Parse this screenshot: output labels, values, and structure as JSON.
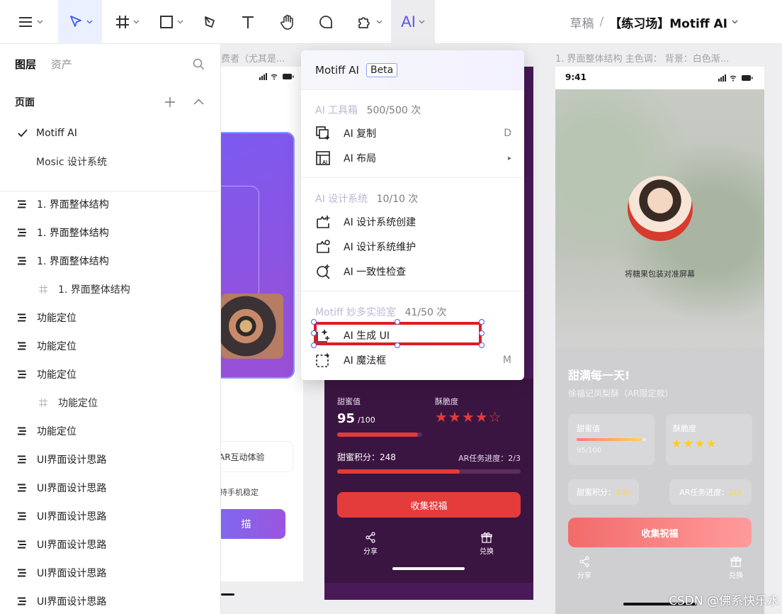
{
  "toolbar": {
    "ai_label": "AI",
    "tools": [
      "menu-icon",
      "pointer-icon",
      "frame-icon",
      "rectangle-icon",
      "pen-icon",
      "text-icon",
      "hand-icon",
      "comment-icon",
      "plugin-icon"
    ]
  },
  "breadcrumb": {
    "project": "草稿",
    "separator": "/",
    "file": "【练习场】Motiff AI"
  },
  "left_panel": {
    "tabs": [
      "图层",
      "资产"
    ],
    "pages_title": "页面",
    "pages": [
      {
        "name": "Motiff AI",
        "current": true
      },
      {
        "name": "Mosic 设计系统",
        "current": false
      }
    ],
    "layers": [
      {
        "name": "1. 界面整体结构",
        "type": "section"
      },
      {
        "name": "1. 界面整体结构",
        "type": "section"
      },
      {
        "name": "1. 界面整体结构",
        "type": "section"
      },
      {
        "name": "1. 界面整体结构",
        "type": "frame"
      },
      {
        "name": "功能定位",
        "type": "section"
      },
      {
        "name": "功能定位",
        "type": "section"
      },
      {
        "name": "功能定位",
        "type": "section"
      },
      {
        "name": "功能定位",
        "type": "frame"
      },
      {
        "name": "功能定位",
        "type": "section"
      },
      {
        "name": "UI界面设计思路",
        "type": "section"
      },
      {
        "name": "UI界面设计思路",
        "type": "section"
      },
      {
        "name": "UI界面设计思路",
        "type": "section"
      },
      {
        "name": "UI界面设计思路",
        "type": "section"
      },
      {
        "name": "UI界面设计思路",
        "type": "section"
      },
      {
        "name": "UI界面设计思路",
        "type": "section"
      }
    ]
  },
  "ai_menu": {
    "title": "Motiff AI",
    "badge": "Beta",
    "sections": [
      {
        "name": "AI 工具箱",
        "quota": "500/500 次",
        "items": [
          {
            "label": "AI 复制",
            "shortcut": "D",
            "icon": "ai-copy-icon"
          },
          {
            "label": "AI 布局",
            "shortcut": "▸",
            "icon": "ai-layout-icon"
          }
        ]
      },
      {
        "name": "AI 设计系统",
        "quota": "10/10 次",
        "items": [
          {
            "label": "AI 设计系统创建",
            "shortcut": "",
            "icon": "ai-ds-create-icon"
          },
          {
            "label": "AI 设计系统维护",
            "shortcut": "",
            "icon": "ai-ds-maintain-icon"
          },
          {
            "label": "AI 一致性检查",
            "shortcut": "",
            "icon": "ai-consistency-icon"
          }
        ]
      },
      {
        "name": "Motiff 妙多实验室",
        "quota": "41/50 次",
        "items": [
          {
            "label": "AI 生成 UI",
            "shortcut": "",
            "icon": "ai-generate-ui-icon",
            "highlighted": true
          },
          {
            "label": "AI 魔法框",
            "shortcut": "M",
            "icon": "ai-magic-box-icon"
          }
        ]
      }
    ]
  },
  "canvas": {
    "frame_label_left": "费者（尤其是...",
    "frame_label_right": "1. 界面整体结构 主色调：  背景：白色渐...",
    "left_frame": {
      "ar_text": "AR互动体验",
      "hint_text": "持手机稳定",
      "button_text": "描"
    },
    "middle_frame": {
      "sweet_label": "甜蜜值",
      "sweet_value": "95",
      "sweet_max": "/100",
      "sweet_progress": 0.95,
      "crisp_label": "酥脆度",
      "stars": "★★★★☆",
      "points_label": "甜蜜积分：248",
      "ar_progress_label": "AR任务进度：2/3",
      "ar_progress": 0.667,
      "collect_button": "收集祝福",
      "share_label": "分享",
      "redeem_label": "兑换"
    },
    "right_frame": {
      "status_time": "9:41",
      "photo_caption": "将糖果包装对准屏幕",
      "heading": "甜满每一天!",
      "subheading": "徐福记凤梨酥（AR限定款）",
      "sweet_label": "甜蜜值",
      "sweet_value": "95/100",
      "sweet_progress": 0.95,
      "crisp_label": "酥脆度",
      "stars": "★★★★",
      "points_label": "甜蜜积分：",
      "points_value": "248",
      "ar_label": "AR任务进度：",
      "ar_value": "2/3",
      "collect_button": "收集祝福",
      "share_label": "分享",
      "redeem_label": "兑换"
    }
  },
  "watermark": "CSDN @佛系快乐水",
  "colors": {
    "accent": "#4b5cf5",
    "selection": "#e01b24",
    "red_button": "#e43b3b",
    "purple_dark": "#3a1240",
    "star": "#e33a3a"
  }
}
